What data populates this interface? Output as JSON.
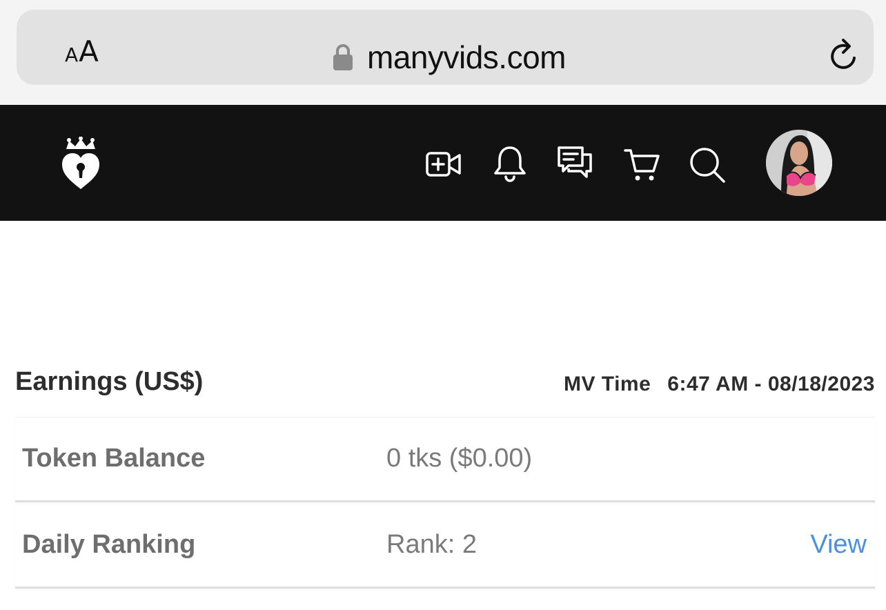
{
  "browser": {
    "aa_small": "A",
    "aa_big": "A",
    "url": "manyvids.com"
  },
  "header": {
    "icons": [
      "logo-heart-crown-icon",
      "upload-video-icon",
      "bell-icon",
      "chat-icon",
      "cart-icon",
      "search-icon",
      "avatar"
    ]
  },
  "earnings": {
    "title": "Earnings (US$)",
    "time_label": "MV Time",
    "time_value": "6:47 AM - 08/18/2023",
    "rows": [
      {
        "label": "Token Balance",
        "value": "0 tks ($0.00)"
      },
      {
        "label": "Daily Ranking",
        "value": "Rank: 2",
        "link": "View"
      }
    ]
  },
  "colors": {
    "header_bg": "#121212",
    "link": "#4a90e2",
    "avatar_accent": "#e8458b"
  }
}
